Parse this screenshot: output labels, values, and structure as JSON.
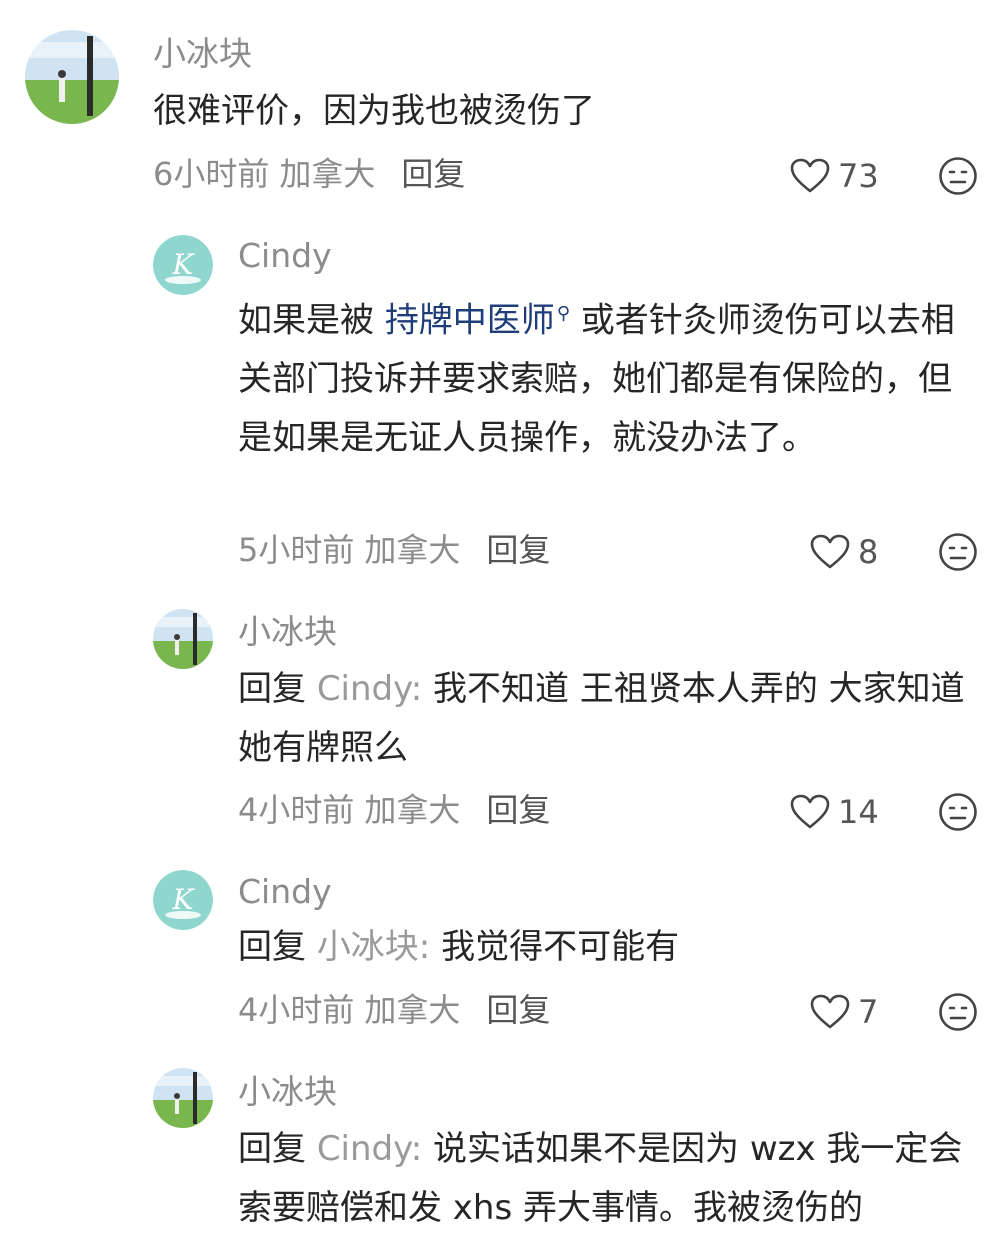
{
  "comments": [
    {
      "username": "小冰块",
      "text": "很难评价，因为我也被烫伤了",
      "time": "6小时前",
      "location": "加拿大",
      "reply_label": "回复",
      "likes": "73"
    },
    {
      "username": "Cindy",
      "text_before": "如果是被 ",
      "link_text": "持牌中医师",
      "text_after": " 或者针灸师烫伤可以去相关部门投诉并要求索赔，她们都是有保险的，但是如果是无证人员操作，就没办法了。",
      "time": "5小时前",
      "location": "加拿大",
      "reply_label": "回复",
      "likes": "8"
    },
    {
      "username": "小冰块",
      "reply_prefix": "回复 ",
      "reply_target": "Cindy:",
      "text": " 我不知道 王祖贤本人弄的 大家知道她有牌照么",
      "time": "4小时前",
      "location": "加拿大",
      "reply_label": "回复",
      "likes": "14"
    },
    {
      "username": "Cindy",
      "reply_prefix": "回复 ",
      "reply_target": "小冰块:",
      "text": " 我觉得不可能有",
      "time": "4小时前",
      "location": "加拿大",
      "reply_label": "回复",
      "likes": "7"
    },
    {
      "username": "小冰块",
      "reply_prefix": "回复 ",
      "reply_target": "Cindy:",
      "text": " 说实话如果不是因为 wzx 我一定会索要赔偿和发 xhs 弄大事情。我被烫伤的",
      "time": "",
      "location": "",
      "reply_label": "",
      "likes": ""
    }
  ],
  "icons": {
    "like": "heart-outline-icon",
    "emoji": "neutral-face-icon",
    "link_search": "search-icon"
  },
  "colors": {
    "username": "#8c8c8c",
    "text": "#262626",
    "link": "#1f3d78",
    "cindy_avatar_bg": "#8fd6cf"
  }
}
